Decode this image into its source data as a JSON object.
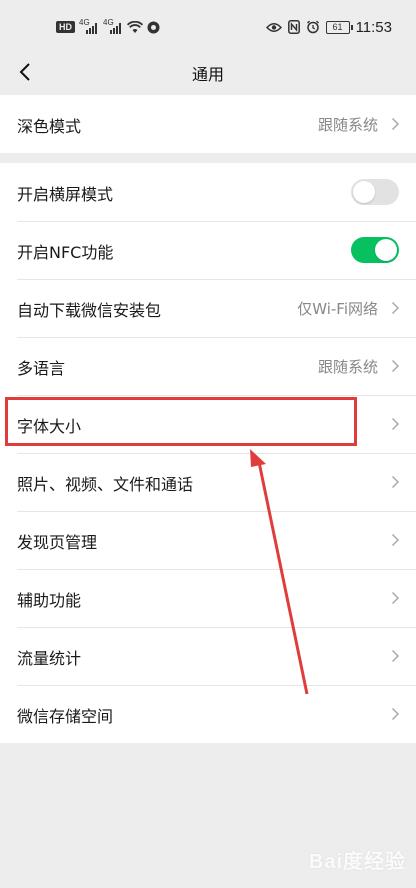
{
  "status_bar": {
    "network_badge": "HD",
    "signal_1": "4G",
    "signal_2": "4G",
    "battery": "61",
    "time": "11:53"
  },
  "header": {
    "title": "通用"
  },
  "groups": [
    {
      "items": [
        {
          "label": "深色模式",
          "value": "跟随系统"
        }
      ]
    },
    {
      "items": [
        {
          "label": "开启横屏模式",
          "toggle": "off"
        },
        {
          "label": "开启NFC功能",
          "toggle": "on"
        },
        {
          "label": "自动下载微信安装包",
          "value": "仅Wi-Fi网络"
        },
        {
          "label": "多语言",
          "value": "跟随系统"
        },
        {
          "label": "字体大小",
          "highlighted": true
        },
        {
          "label": "照片、视频、文件和通话"
        },
        {
          "label": "发现页管理"
        },
        {
          "label": "辅助功能"
        },
        {
          "label": "流量统计"
        },
        {
          "label": "微信存储空间"
        }
      ]
    }
  ],
  "colors": {
    "background": "#ededed",
    "toggle_on": "#07c160",
    "toggle_off": "#e2e2e2",
    "highlight": "#e03c3c"
  },
  "watermark": "Bai度经验"
}
